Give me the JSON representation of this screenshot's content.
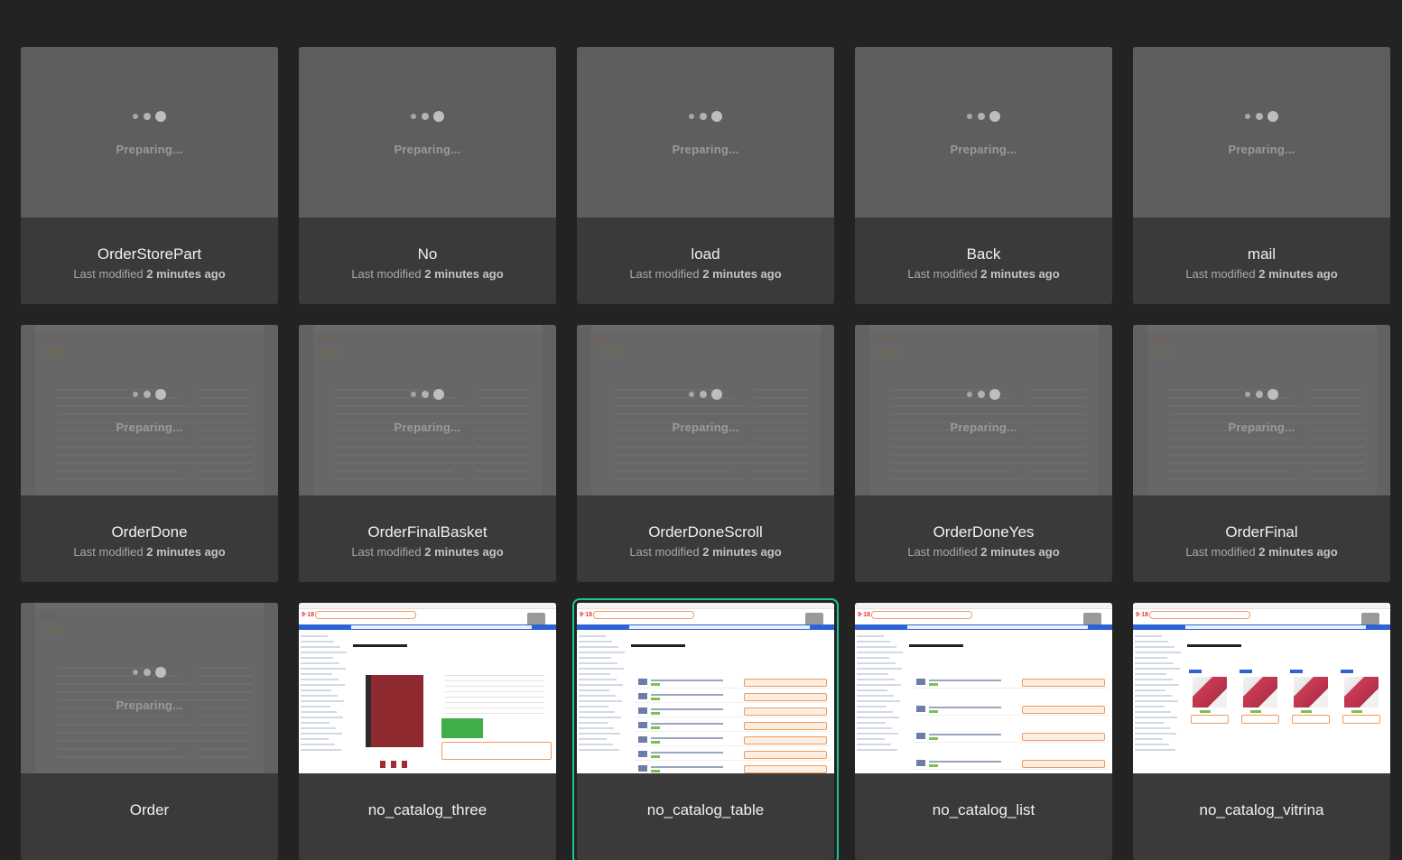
{
  "status_text": "Preparing...",
  "meta_prefix": "Last modified",
  "cards": [
    {
      "name": "OrderStorePart",
      "modified": "2 minutes ago",
      "thumb": "blank",
      "preparing": true
    },
    {
      "name": "No",
      "modified": "2 minutes ago",
      "thumb": "blank",
      "preparing": true
    },
    {
      "name": "load",
      "modified": "2 minutes ago",
      "thumb": "blank",
      "preparing": true
    },
    {
      "name": "Back",
      "modified": "2 minutes ago",
      "thumb": "blank",
      "preparing": true
    },
    {
      "name": "mail",
      "modified": "2 minutes ago",
      "thumb": "blank",
      "preparing": true
    },
    {
      "name": "OrderDone",
      "modified": "2 minutes ago",
      "thumb": "faded",
      "preparing": true
    },
    {
      "name": "OrderFinalBasket",
      "modified": "2 minutes ago",
      "thumb": "faded",
      "preparing": true
    },
    {
      "name": "OrderDoneScroll",
      "modified": "2 minutes ago",
      "thumb": "faded",
      "preparing": true
    },
    {
      "name": "OrderDoneYes",
      "modified": "2 minutes ago",
      "thumb": "faded",
      "preparing": true
    },
    {
      "name": "OrderFinal",
      "modified": "2 minutes ago",
      "thumb": "faded",
      "preparing": true
    },
    {
      "name": "Order",
      "modified": "",
      "thumb": "faded",
      "preparing": true
    },
    {
      "name": "no_catalog_three",
      "modified": "",
      "thumb": "product",
      "preparing": false
    },
    {
      "name": "no_catalog_table",
      "modified": "",
      "thumb": "table",
      "preparing": false,
      "selected": true
    },
    {
      "name": "no_catalog_list",
      "modified": "",
      "thumb": "list",
      "preparing": false
    },
    {
      "name": "no_catalog_vitrina",
      "modified": "",
      "thumb": "vitrina",
      "preparing": false
    }
  ]
}
